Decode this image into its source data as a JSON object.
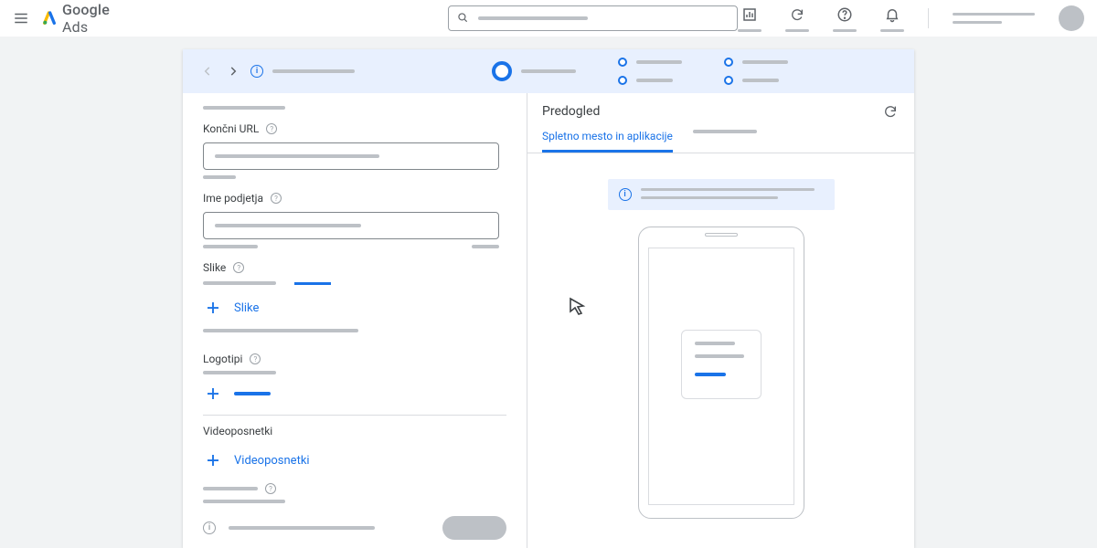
{
  "brand": {
    "word1": "Google",
    "word2": "Ads"
  },
  "form": {
    "label_final_url": "Končni URL",
    "label_business": "Ime podjetja",
    "label_images": "Slike",
    "add_images": "Slike",
    "label_logos": "Logotipi",
    "label_videos": "Videoposnetki",
    "add_videos": "Videoposnetki"
  },
  "preview": {
    "title": "Predogled",
    "tab1": "Spletno mesto in aplikacije"
  }
}
